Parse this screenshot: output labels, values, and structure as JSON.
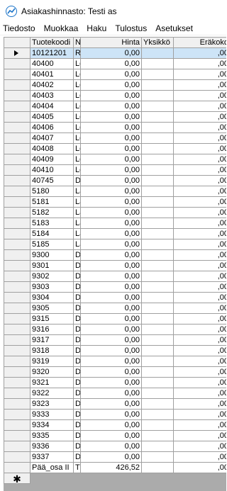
{
  "window": {
    "title": "Asiakashinnasto: Testi as",
    "icon": "chart-line-icon"
  },
  "menu": [
    "Tiedosto",
    "Muokkaa",
    "Haku",
    "Tulostus",
    "Asetukset"
  ],
  "grid": {
    "headers": [
      "Tuotekoodi",
      "N",
      "Hinta",
      "Yksikkö",
      "Eräkoko"
    ],
    "rows": [
      [
        "10121201",
        "R",
        "0,00",
        "",
        ",00"
      ],
      [
        "40400",
        "Le",
        "0,00",
        "",
        ",00"
      ],
      [
        "40401",
        "Le",
        "0,00",
        "",
        ",00"
      ],
      [
        "40402",
        "Le",
        "0,00",
        "",
        ",00"
      ],
      [
        "40403",
        "Le",
        "0,00",
        "",
        ",00"
      ],
      [
        "40404",
        "Le",
        "0,00",
        "",
        ",00"
      ],
      [
        "40405",
        "Le",
        "0,00",
        "",
        ",00"
      ],
      [
        "40406",
        "Le",
        "0,00",
        "",
        ",00"
      ],
      [
        "40407",
        "Le",
        "0,00",
        "",
        ",00"
      ],
      [
        "40408",
        "Le",
        "0,00",
        "",
        ",00"
      ],
      [
        "40409",
        "Le",
        "0,00",
        "",
        ",00"
      ],
      [
        "40410",
        "Le",
        "0,00",
        "",
        ",00"
      ],
      [
        "40745",
        "D",
        "0,00",
        "",
        ",00"
      ],
      [
        "5180",
        "La",
        "0,00",
        "",
        ",00"
      ],
      [
        "5181",
        "La",
        "0,00",
        "",
        ",00"
      ],
      [
        "5182",
        "La",
        "0,00",
        "",
        ",00"
      ],
      [
        "5183",
        "La",
        "0,00",
        "",
        ",00"
      ],
      [
        "5184",
        "La",
        "0,00",
        "",
        ",00"
      ],
      [
        "5185",
        "La",
        "0,00",
        "",
        ",00"
      ],
      [
        "9300",
        "D",
        "0,00",
        "",
        ",00"
      ],
      [
        "9301",
        "D",
        "0,00",
        "",
        ",00"
      ],
      [
        "9302",
        "D",
        "0,00",
        "",
        ",00"
      ],
      [
        "9303",
        "D",
        "0,00",
        "",
        ",00"
      ],
      [
        "9304",
        "D",
        "0,00",
        "",
        ",00"
      ],
      [
        "9305",
        "D",
        "0,00",
        "",
        ",00"
      ],
      [
        "9315",
        "D",
        "0,00",
        "",
        ",00"
      ],
      [
        "9316",
        "D",
        "0,00",
        "",
        ",00"
      ],
      [
        "9317",
        "D",
        "0,00",
        "",
        ",00"
      ],
      [
        "9318",
        "D",
        "0,00",
        "",
        ",00"
      ],
      [
        "9319",
        "D",
        "0,00",
        "",
        ",00"
      ],
      [
        "9320",
        "D",
        "0,00",
        "",
        ",00"
      ],
      [
        "9321",
        "D",
        "0,00",
        "",
        ",00"
      ],
      [
        "9322",
        "D",
        "0,00",
        "",
        ",00"
      ],
      [
        "9323",
        "D",
        "0,00",
        "",
        ",00"
      ],
      [
        "9333",
        "D",
        "0,00",
        "",
        ",00"
      ],
      [
        "9334",
        "D",
        "0,00",
        "",
        ",00"
      ],
      [
        "9335",
        "D",
        "0,00",
        "",
        ",00"
      ],
      [
        "9336",
        "D",
        "0,00",
        "",
        ",00"
      ],
      [
        "9337",
        "D",
        "0,00",
        "",
        ",00"
      ],
      [
        "Pää_osa II",
        "T",
        "426,52",
        "",
        ",00"
      ]
    ],
    "selected_row": 0,
    "new_row_marker": "✱"
  },
  "colors": {
    "selection": "#cde4f7",
    "header": "#f0f0f0",
    "empty_area": "#ababab",
    "gridline": "#a0a0a0"
  }
}
